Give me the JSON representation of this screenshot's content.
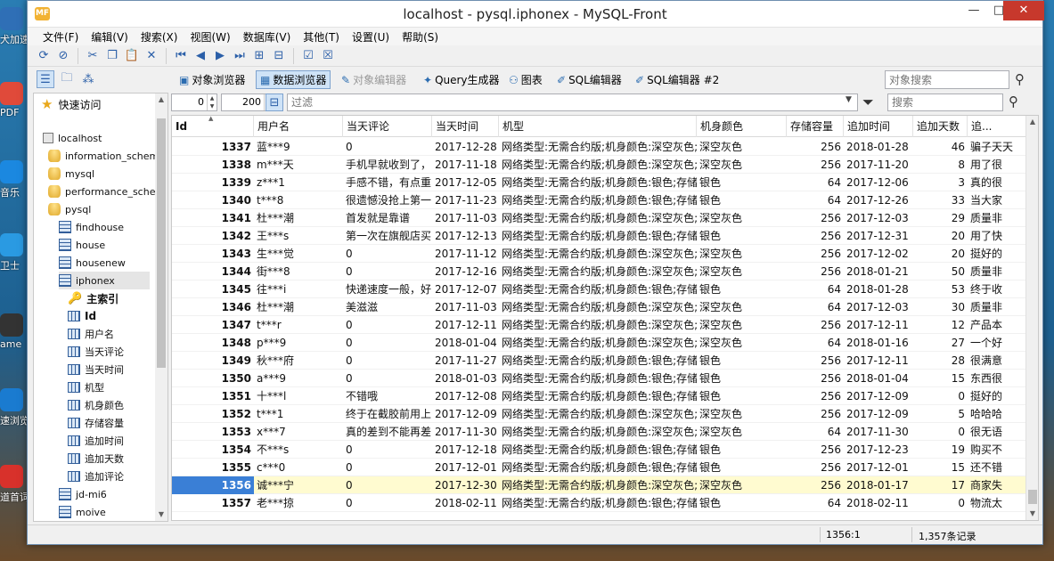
{
  "window": {
    "title": "localhost - pysql.iphonex - MySQL-Front",
    "logo_text": "MF",
    "minimize": "—",
    "maximize": "□",
    "close": "✕"
  },
  "desktop_icons": [
    {
      "label": "犬加速",
      "color": "#2f6fb6"
    },
    {
      "label": "PDF",
      "color": "#e04a3a"
    },
    {
      "label": "音乐",
      "color": "#1b88e0"
    },
    {
      "label": "卫士",
      "color": "#2a9ae2"
    },
    {
      "label": "ame",
      "color": "#333333"
    },
    {
      "label": "速浏览",
      "color": "#1a7bd0"
    },
    {
      "label": "道首词典",
      "color": "#d8312b"
    }
  ],
  "menu": [
    "文件(F)",
    "编辑(V)",
    "搜索(X)",
    "视图(W)",
    "数据库(V)",
    "其他(T)",
    "设置(U)",
    "帮助(S)"
  ],
  "view_tabs": [
    {
      "label": "对象浏览器",
      "state": "normal"
    },
    {
      "label": "数据浏览器",
      "state": "active"
    },
    {
      "label": "对象编辑器",
      "state": "disabled"
    },
    {
      "label": "Query生成器",
      "state": "normal"
    },
    {
      "label": "图表",
      "state": "normal"
    },
    {
      "label": "SQL编辑器",
      "state": "normal"
    },
    {
      "label": "SQL编辑器 #2",
      "state": "normal"
    }
  ],
  "object_search": {
    "placeholder": "对象搜索"
  },
  "favorites": {
    "label": "快速访问"
  },
  "tree": [
    {
      "label": "localhost",
      "type": "host",
      "indent": 0
    },
    {
      "label": "information_schema",
      "type": "db",
      "indent": 1
    },
    {
      "label": "mysql",
      "type": "db",
      "indent": 1
    },
    {
      "label": "performance_schema",
      "type": "db",
      "indent": 1
    },
    {
      "label": "pysql",
      "type": "db",
      "indent": 1
    },
    {
      "label": "findhouse",
      "type": "table",
      "indent": 2
    },
    {
      "label": "house",
      "type": "table",
      "indent": 2
    },
    {
      "label": "housenew",
      "type": "table",
      "indent": 2
    },
    {
      "label": "iphonex",
      "type": "table",
      "indent": 2,
      "selected": true
    },
    {
      "label": "主索引",
      "type": "key",
      "indent": 3,
      "bold": true
    },
    {
      "label": "Id",
      "type": "field",
      "indent": 3,
      "bold": true
    },
    {
      "label": "用户名",
      "type": "field",
      "indent": 3
    },
    {
      "label": "当天评论",
      "type": "field",
      "indent": 3
    },
    {
      "label": "当天时间",
      "type": "field",
      "indent": 3
    },
    {
      "label": "机型",
      "type": "field",
      "indent": 3
    },
    {
      "label": "机身颜色",
      "type": "field",
      "indent": 3
    },
    {
      "label": "存储容量",
      "type": "field",
      "indent": 3
    },
    {
      "label": "追加时间",
      "type": "field",
      "indent": 3
    },
    {
      "label": "追加天数",
      "type": "field",
      "indent": 3
    },
    {
      "label": "追加评论",
      "type": "field",
      "indent": 3
    },
    {
      "label": "jd-mi6",
      "type": "table",
      "indent": 2
    },
    {
      "label": "moive",
      "type": "table",
      "indent": 2
    }
  ],
  "filter": {
    "offset": "0",
    "limit": "200",
    "placeholder": "过滤",
    "search_placeholder": "搜索"
  },
  "grid": {
    "columns": [
      "Id",
      "用户名",
      "当天评论",
      "当天时间",
      "机型",
      "机身颜色",
      "存储容量",
      "追加时间",
      "追加天数",
      "追..."
    ],
    "rows": [
      [
        "1337",
        "蓝***9",
        "0",
        "2017-12-28",
        "网络类型:无需合约版;机身颜色:深空灰色;",
        "深空灰色",
        "256",
        "2018-01-28",
        "46",
        "骗子天天"
      ],
      [
        "1338",
        "m***天",
        "手机早就收到了，",
        "2017-11-18",
        "网络类型:无需合约版;机身颜色:深空灰色;",
        "深空灰色",
        "256",
        "2017-11-20",
        "8",
        "用了很"
      ],
      [
        "1339",
        "z***1",
        "手感不错，有点重",
        "2017-12-05",
        "网络类型:无需合约版;机身颜色:银色;存储",
        "银色",
        "64",
        "2017-12-06",
        "3",
        "真的很"
      ],
      [
        "1340",
        "t***8",
        "很遗憾没抢上第一",
        "2017-11-23",
        "网络类型:无需合约版;机身颜色:银色;存储",
        "银色",
        "64",
        "2017-12-26",
        "33",
        "当大家"
      ],
      [
        "1341",
        "杜***潮",
        "首发就是靠谱",
        "2017-11-03",
        "网络类型:无需合约版;机身颜色:深空灰色;",
        "深空灰色",
        "256",
        "2017-12-03",
        "29",
        "质量非"
      ],
      [
        "1342",
        "王***s",
        "第一次在旗舰店买",
        "2017-12-13",
        "网络类型:无需合约版;机身颜色:银色;存储",
        "银色",
        "256",
        "2017-12-31",
        "20",
        "用了快"
      ],
      [
        "1343",
        "生***觉",
        "0",
        "2017-11-12",
        "网络类型:无需合约版;机身颜色:深空灰色;",
        "深空灰色",
        "256",
        "2017-12-02",
        "20",
        "挺好的"
      ],
      [
        "1344",
        "街***8",
        "0",
        "2017-12-16",
        "网络类型:无需合约版;机身颜色:深空灰色;",
        "深空灰色",
        "256",
        "2018-01-21",
        "50",
        "质量非"
      ],
      [
        "1345",
        "往***i",
        "快递速度一般，好",
        "2017-12-07",
        "网络类型:无需合约版;机身颜色:银色;存储",
        "银色",
        "64",
        "2018-01-28",
        "53",
        "终于收"
      ],
      [
        "1346",
        "杜***潮",
        "美滋滋",
        "2017-11-03",
        "网络类型:无需合约版;机身颜色:深空灰色;",
        "深空灰色",
        "64",
        "2017-12-03",
        "30",
        "质量非"
      ],
      [
        "1347",
        "t***r",
        "0",
        "2017-12-11",
        "网络类型:无需合约版;机身颜色:深空灰色;",
        "深空灰色",
        "256",
        "2017-12-11",
        "12",
        "产品本"
      ],
      [
        "1348",
        "p***9",
        "0",
        "2018-01-04",
        "网络类型:无需合约版;机身颜色:深空灰色;",
        "深空灰色",
        "64",
        "2018-01-16",
        "27",
        "一个好"
      ],
      [
        "1349",
        "秋***府",
        "0",
        "2017-11-27",
        "网络类型:无需合约版;机身颜色:银色;存储",
        "银色",
        "256",
        "2017-12-11",
        "28",
        "很满意"
      ],
      [
        "1350",
        "a***9",
        "0",
        "2018-01-03",
        "网络类型:无需合约版;机身颜色:银色;存储",
        "银色",
        "256",
        "2018-01-04",
        "15",
        "东西很"
      ],
      [
        "1351",
        "十***l",
        "不错哦",
        "2017-12-08",
        "网络类型:无需合约版;机身颜色:银色;存储",
        "银色",
        "256",
        "2017-12-09",
        "0",
        "挺好的"
      ],
      [
        "1352",
        "t***1",
        "终于在截胶前用上",
        "2017-12-09",
        "网络类型:无需合约版;机身颜色:深空灰色;",
        "深空灰色",
        "256",
        "2017-12-09",
        "5",
        "哈哈哈"
      ],
      [
        "1353",
        "x***7",
        "真的差到不能再差",
        "2017-11-30",
        "网络类型:无需合约版;机身颜色:深空灰色;",
        "深空灰色",
        "64",
        "2017-11-30",
        "0",
        "很无语"
      ],
      [
        "1354",
        "不***s",
        "0",
        "2017-12-18",
        "网络类型:无需合约版;机身颜色:银色;存储",
        "银色",
        "256",
        "2017-12-23",
        "19",
        "购买不"
      ],
      [
        "1355",
        "c***0",
        "0",
        "2017-12-01",
        "网络类型:无需合约版;机身颜色:银色;存储",
        "银色",
        "256",
        "2017-12-01",
        "15",
        "还不错"
      ],
      [
        "1356",
        "诚***宁",
        "0",
        "2017-12-30",
        "网络类型:无需合约版;机身颜色:深空灰色;",
        "深空灰色",
        "256",
        "2018-01-17",
        "17",
        "商家失"
      ],
      [
        "1357",
        "老***掠",
        "0",
        "2018-02-11",
        "网络类型:无需合约版;机身颜色:银色;存储",
        "银色",
        "64",
        "2018-02-11",
        "0",
        "物流太"
      ]
    ],
    "current_row": 19
  },
  "status": {
    "position": "1356:1",
    "record_count": "1,357条记录"
  }
}
